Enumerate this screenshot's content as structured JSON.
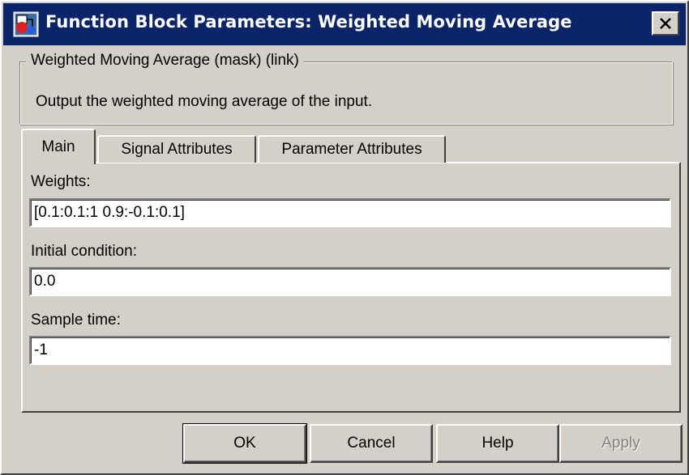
{
  "window": {
    "title": "Function Block Parameters: Weighted Moving Average",
    "icon": "simulink-block-icon",
    "close_icon": "close-icon"
  },
  "mask": {
    "group_title": "Weighted Moving Average (mask) (link)",
    "description": "Output the weighted moving average of the input."
  },
  "tabs": [
    {
      "label": "Main",
      "active": true
    },
    {
      "label": "Signal Attributes",
      "active": false
    },
    {
      "label": "Parameter Attributes",
      "active": false
    }
  ],
  "fields": {
    "weights": {
      "label": "Weights:",
      "value": "[0.1:0.1:1 0.9:-0.1:0.1]"
    },
    "initial_condition": {
      "label": "Initial condition:",
      "value": "0.0"
    },
    "sample_time": {
      "label": "Sample time:",
      "value": "-1"
    }
  },
  "buttons": {
    "ok": "OK",
    "cancel": "Cancel",
    "help": "Help",
    "apply": "Apply"
  },
  "colors": {
    "titlebar": "#0a246a",
    "face": "#d4d0c8",
    "disabled_text": "#808080"
  }
}
